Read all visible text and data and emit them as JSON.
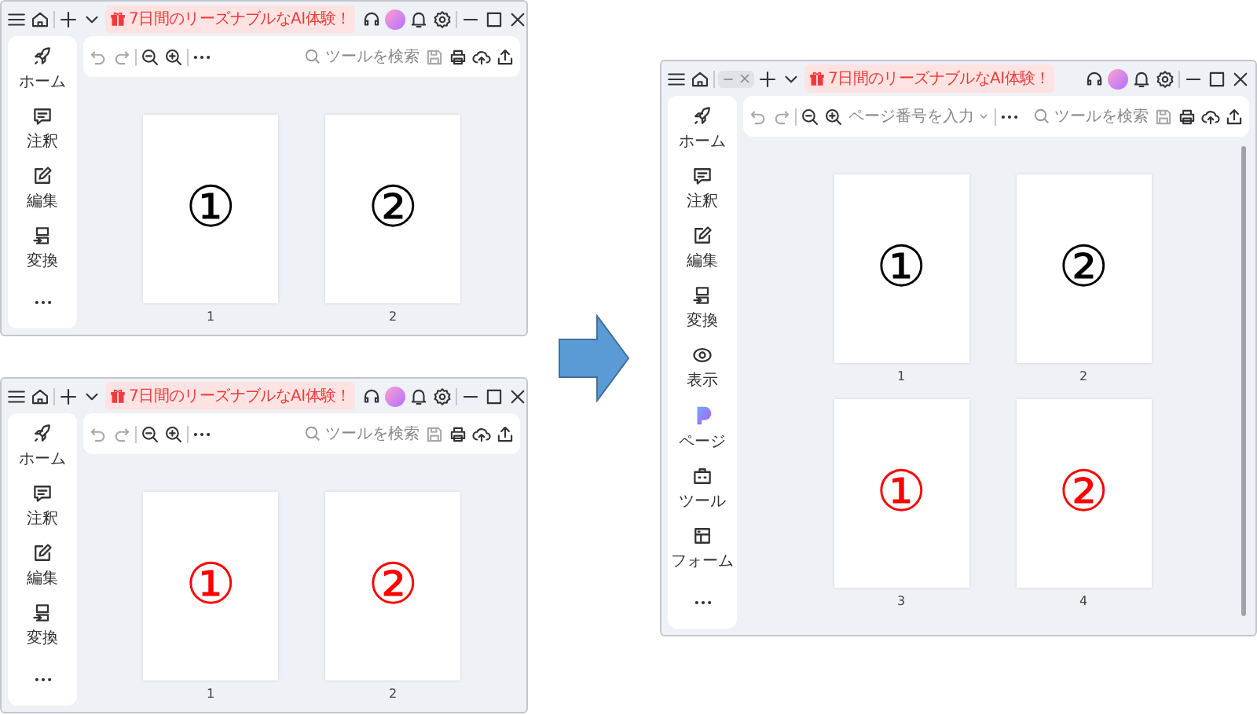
{
  "windows": [
    {
      "tab_open": false,
      "promo": "7日間のリーズナブルなAI体験！",
      "sidebar": [
        {
          "kind": "rocket",
          "label": "ホーム"
        },
        {
          "kind": "comment",
          "label": "注釈"
        },
        {
          "kind": "edit",
          "label": "編集"
        },
        {
          "kind": "convert",
          "label": "変換"
        }
      ],
      "search_placeholder": "ツールを検索",
      "scrollbar": false,
      "pages": [
        {
          "mark": "①",
          "color": "#000000",
          "number": "1"
        },
        {
          "mark": "②",
          "color": "#000000",
          "number": "2"
        }
      ]
    },
    {
      "tab_open": false,
      "promo": "7日間のリーズナブルなAI体験！",
      "sidebar": [
        {
          "kind": "rocket",
          "label": "ホーム"
        },
        {
          "kind": "comment",
          "label": "注釈"
        },
        {
          "kind": "edit",
          "label": "編集"
        },
        {
          "kind": "convert",
          "label": "変換"
        }
      ],
      "search_placeholder": "ツールを検索",
      "scrollbar": false,
      "pages": [
        {
          "mark": "①",
          "color": "#ff0000",
          "number": "1"
        },
        {
          "mark": "②",
          "color": "#ff0000",
          "number": "2"
        }
      ]
    },
    {
      "tab_open": true,
      "promo": "7日間のリーズナブルなAI体験！",
      "sidebar": [
        {
          "kind": "rocket",
          "label": "ホーム"
        },
        {
          "kind": "comment",
          "label": "注釈"
        },
        {
          "kind": "edit",
          "label": "編集"
        },
        {
          "kind": "convert",
          "label": "変換"
        },
        {
          "kind": "view",
          "label": "表示"
        },
        {
          "kind": "page",
          "label": "ページ"
        },
        {
          "kind": "tool",
          "label": "ツール"
        },
        {
          "kind": "form",
          "label": "フォーム"
        }
      ],
      "page_number_placeholder": "ページ番号を入力",
      "search_placeholder": "ツールを検索",
      "scrollbar": true,
      "pages": [
        {
          "mark": "①",
          "color": "#000000",
          "number": "1"
        },
        {
          "mark": "②",
          "color": "#000000",
          "number": "2"
        },
        {
          "mark": "①",
          "color": "#ff0000",
          "number": "3"
        },
        {
          "mark": "②",
          "color": "#ff0000",
          "number": "4"
        }
      ]
    }
  ]
}
